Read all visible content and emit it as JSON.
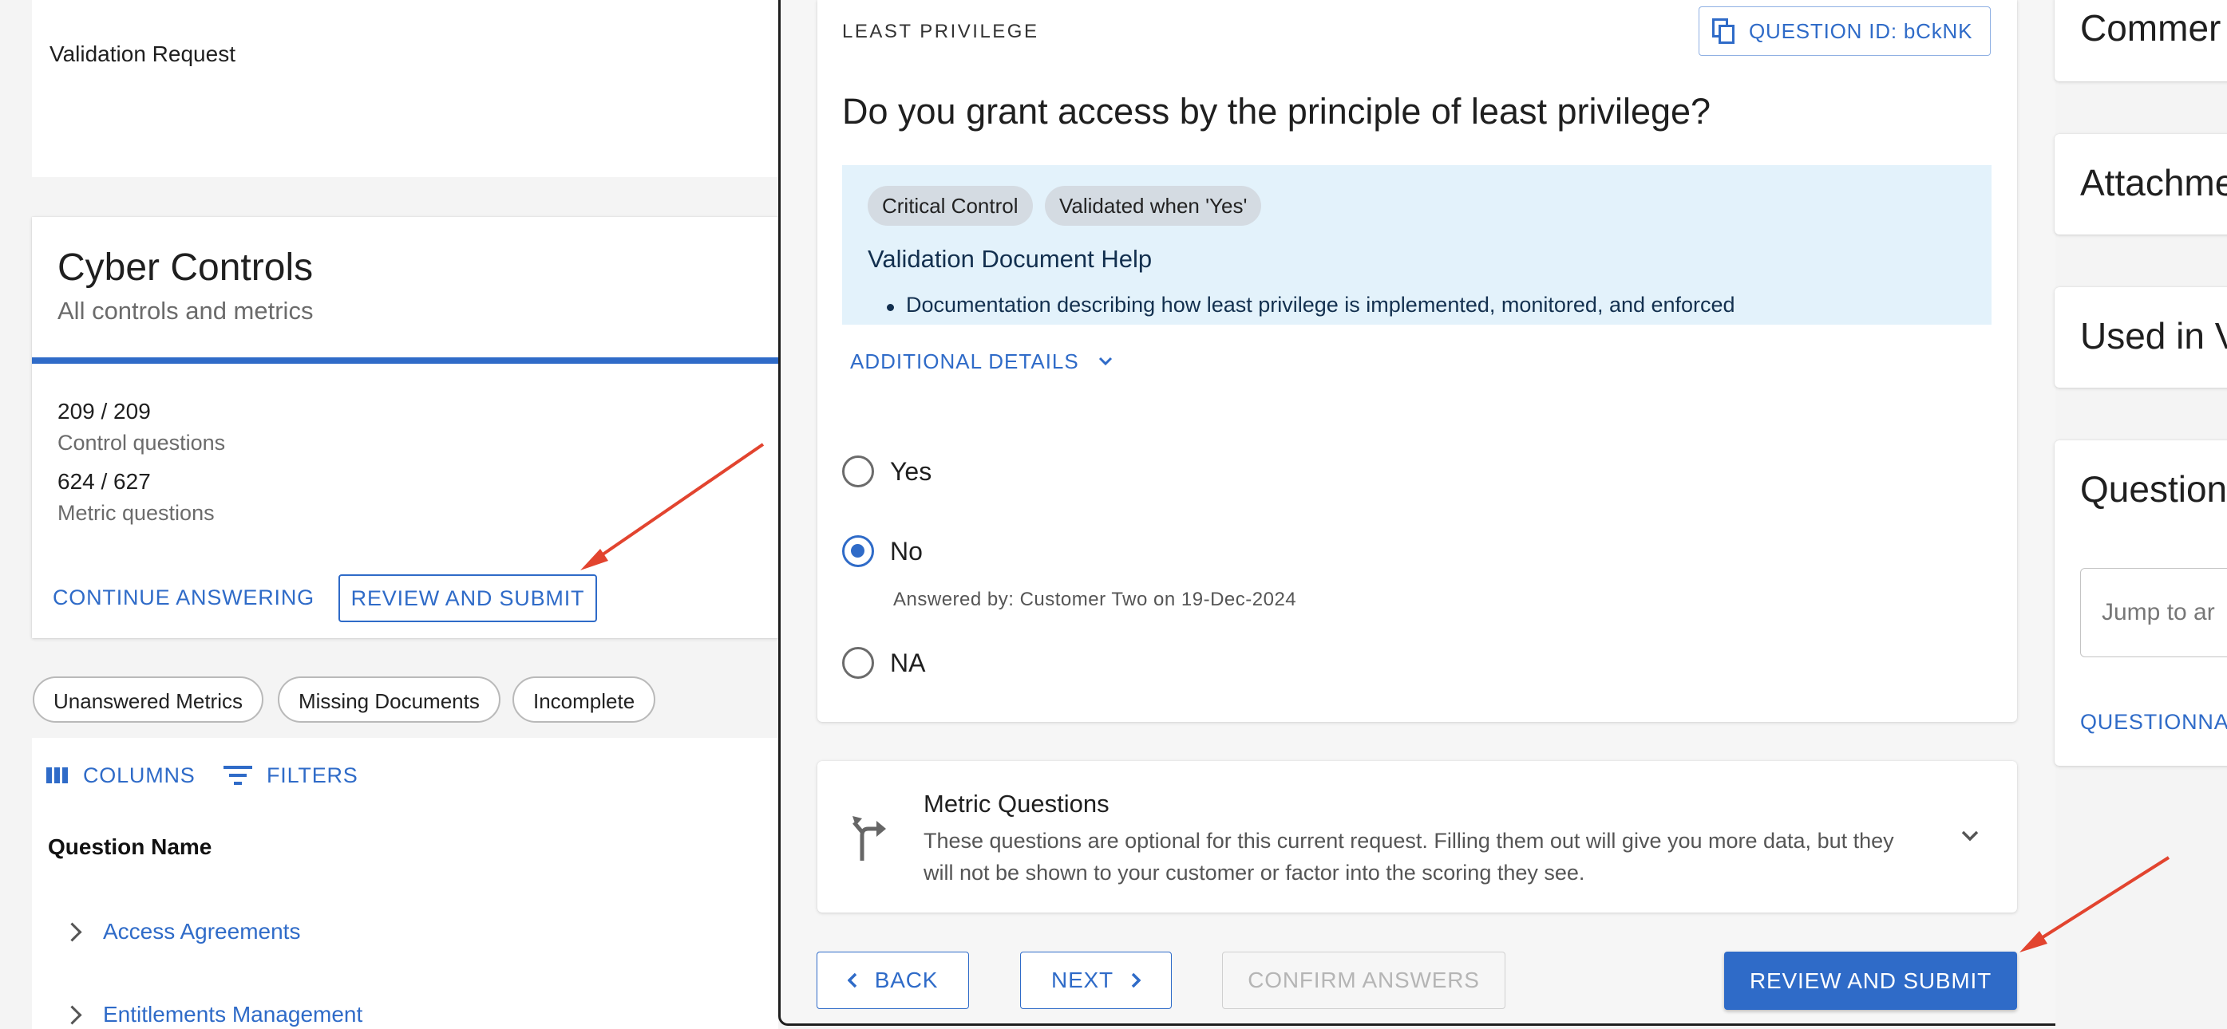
{
  "left_panel": {
    "validation_request_label": "Validation Request",
    "cyber_controls": {
      "title": "Cyber Controls",
      "subtitle": "All controls and metrics",
      "control_count": "209 / 209",
      "control_label": "Control questions",
      "metric_count": "624 / 627",
      "metric_label": "Metric questions",
      "continue_label": "CONTINUE ANSWERING",
      "review_label": "REVIEW AND SUBMIT"
    },
    "filter_chips": [
      "Unanswered Metrics",
      "Missing Documents",
      "Incomplete"
    ],
    "toolbar": {
      "columns_label": "COLUMNS",
      "filters_label": "FILTERS"
    },
    "table": {
      "header": "Question Name",
      "rows": [
        "Access Agreements",
        "Entitlements Management"
      ]
    }
  },
  "question": {
    "category": "LEAST PRIVILEGE",
    "id_label": "QUESTION ID: bCkNK",
    "text": "Do you grant access by the principle of least privilege?",
    "tags": [
      "Critical Control",
      "Validated when 'Yes'"
    ],
    "help_title": "Validation Document Help",
    "help_bullet": "Documentation describing how least privilege is implemented, monitored, and enforced",
    "additional_details_label": "ADDITIONAL DETAILS",
    "options": [
      {
        "label": "Yes",
        "selected": false
      },
      {
        "label": "No",
        "selected": true
      },
      {
        "label": "NA",
        "selected": false
      }
    ],
    "answered_by": "Answered by: Customer Two on 19-Dec-2024"
  },
  "metric_section": {
    "title": "Metric Questions",
    "description": "These questions are optional for this current request. Filling them out will give you more data, but they will not be shown to your customer or factor into the scoring they see."
  },
  "footer": {
    "back_label": "BACK",
    "next_label": "NEXT",
    "confirm_label": "CONFIRM ANSWERS",
    "review_label": "REVIEW AND SUBMIT"
  },
  "right_panel": {
    "comments_title": "Commer",
    "attachments_title": "Attachme",
    "used_in_title": "Used in V",
    "questionnaire_title": "Question",
    "jump_placeholder": "Jump to ar",
    "questionnaire_link": "QUESTIONNA"
  },
  "colors": {
    "accent": "#2f6bc8",
    "help_background": "#e3f2fb",
    "annotation_arrow": "#e2442f"
  },
  "icons": {
    "copy": "copy-icon",
    "chevron_down": "chevron-down-icon",
    "chevron_right": "chevron-right-icon",
    "chevron_left": "chevron-left-icon",
    "columns": "columns-icon",
    "filter": "filter-icon",
    "metric": "branch-arrow-icon"
  }
}
